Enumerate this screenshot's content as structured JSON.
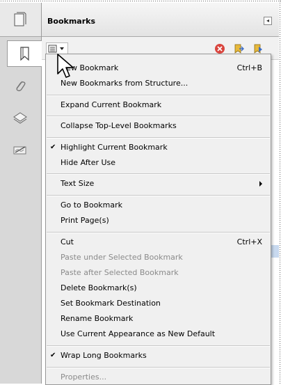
{
  "panel": {
    "title": "Bookmarks",
    "collapse_glyph": "◂"
  },
  "menu": {
    "items": [
      {
        "label": "New Bookmark",
        "shortcut": "Ctrl+B",
        "checked": false,
        "disabled": false,
        "submenu": false
      },
      {
        "label": "New Bookmarks from Structure...",
        "shortcut": "",
        "checked": false,
        "disabled": false,
        "submenu": false
      },
      {
        "label": "Expand Current Bookmark",
        "shortcut": "",
        "checked": false,
        "disabled": false,
        "submenu": false
      },
      {
        "label": "Collapse Top-Level Bookmarks",
        "shortcut": "",
        "checked": false,
        "disabled": false,
        "submenu": false
      },
      {
        "label": "Highlight Current Bookmark",
        "shortcut": "",
        "checked": true,
        "disabled": false,
        "submenu": false
      },
      {
        "label": "Hide After Use",
        "shortcut": "",
        "checked": false,
        "disabled": false,
        "submenu": false
      },
      {
        "label": "Text Size",
        "shortcut": "",
        "checked": false,
        "disabled": false,
        "submenu": true
      },
      {
        "label": "Go to Bookmark",
        "shortcut": "",
        "checked": false,
        "disabled": false,
        "submenu": false
      },
      {
        "label": "Print Page(s)",
        "shortcut": "",
        "checked": false,
        "disabled": false,
        "submenu": false
      },
      {
        "label": "Cut",
        "shortcut": "Ctrl+X",
        "checked": false,
        "disabled": false,
        "submenu": false
      },
      {
        "label": "Paste under Selected Bookmark",
        "shortcut": "",
        "checked": false,
        "disabled": true,
        "submenu": false
      },
      {
        "label": "Paste after Selected Bookmark",
        "shortcut": "",
        "checked": false,
        "disabled": true,
        "submenu": false
      },
      {
        "label": "Delete Bookmark(s)",
        "shortcut": "",
        "checked": false,
        "disabled": false,
        "submenu": false
      },
      {
        "label": "Set Bookmark Destination",
        "shortcut": "",
        "checked": false,
        "disabled": false,
        "submenu": false
      },
      {
        "label": "Rename Bookmark",
        "shortcut": "",
        "checked": false,
        "disabled": false,
        "submenu": false
      },
      {
        "label": "Use Current Appearance as New Default",
        "shortcut": "",
        "checked": false,
        "disabled": false,
        "submenu": false
      },
      {
        "label": "Wrap Long Bookmarks",
        "shortcut": "",
        "checked": true,
        "disabled": false,
        "submenu": false
      },
      {
        "label": "Properties...",
        "shortcut": "",
        "checked": false,
        "disabled": true,
        "submenu": false
      }
    ],
    "check_glyph": "✔"
  },
  "icons": {
    "rail": [
      "pages-icon",
      "bookmarks-icon",
      "attachments-icon",
      "layers-icon",
      "signatures-icon"
    ],
    "toolbar": [
      "options-menu-icon",
      "delete-bookmark-icon",
      "expand-bookmark-icon",
      "new-bookmark-icon"
    ]
  },
  "colors": {
    "delete_red": "#d9453e",
    "bookmark_yellow": "#e7b93c",
    "bookmark_blue": "#3d6ec6",
    "rail_bg": "#d8d8d8"
  }
}
